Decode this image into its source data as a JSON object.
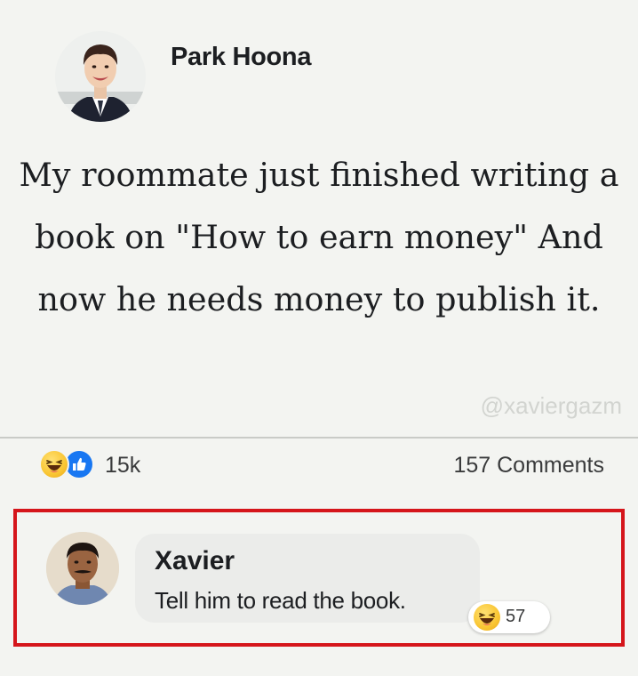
{
  "post": {
    "author_name": "Park Hoona",
    "text": "My roommate just finished writing a book on \"How to earn money\" And now he needs money to publish it.",
    "watermark": "@xaviergazm",
    "reaction_count": "15k",
    "comment_count": "157 Comments",
    "reaction_icons": [
      "haha-icon",
      "like-icon"
    ]
  },
  "comment": {
    "author_name": "Xavier",
    "text": "Tell him to read the book.",
    "reaction_icon": "haha-icon",
    "reaction_count": "57",
    "highlight_color": "#d5151b"
  },
  "colors": {
    "background": "#f3f4f1",
    "like_blue": "#1877f2",
    "haha_yellow": "#f9c532"
  }
}
